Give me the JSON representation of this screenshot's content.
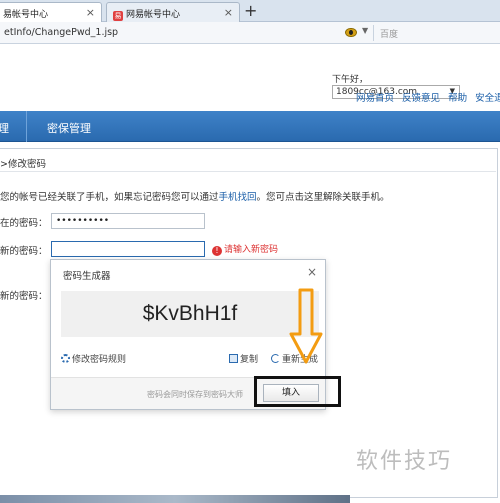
{
  "browser": {
    "tabs": [
      {
        "label": "易帐号中心"
      },
      {
        "label": "网易帐号中心"
      }
    ],
    "new_tab": "+",
    "url": "etInfo/ChangePwd_1.jsp",
    "search_placeholder": "百度"
  },
  "header": {
    "account_label": "下午好，",
    "account_value": "1809cc@163.com",
    "links": [
      "网易首页",
      "反馈意见",
      "帮助",
      "安全退出"
    ]
  },
  "nav": {
    "items": [
      "理",
      "密保管理"
    ]
  },
  "content": {
    "breadcrumb": ">修改密码",
    "notice_prefix": "您的帐号已经关联了手机，如果忘记密码您可以通过",
    "notice_link": "手机找回",
    "notice_suffix": "。您可点击这里解除关联手机。",
    "rows": [
      {
        "label": "在的密码：",
        "value": "••••••••••"
      },
      {
        "label": "新的密码：",
        "value": ""
      },
      {
        "label": "新的密码：",
        "value": ""
      }
    ],
    "error_text": "请输入新密码"
  },
  "generator": {
    "title": "密码生成器",
    "password": "$KvBhH1f",
    "rule_link": "修改密码规则",
    "copy_label": "复制",
    "regenerate_label": "重新生成",
    "footer_text": "密码会同时保存到密码大师",
    "fill_button": "填入"
  },
  "watermark": "软件技巧",
  "colors": {
    "nav_blue": "#2a6aaf",
    "link_blue": "#1a5ea8",
    "error_red": "#d33333",
    "annotation_orange": "#f39c12"
  }
}
